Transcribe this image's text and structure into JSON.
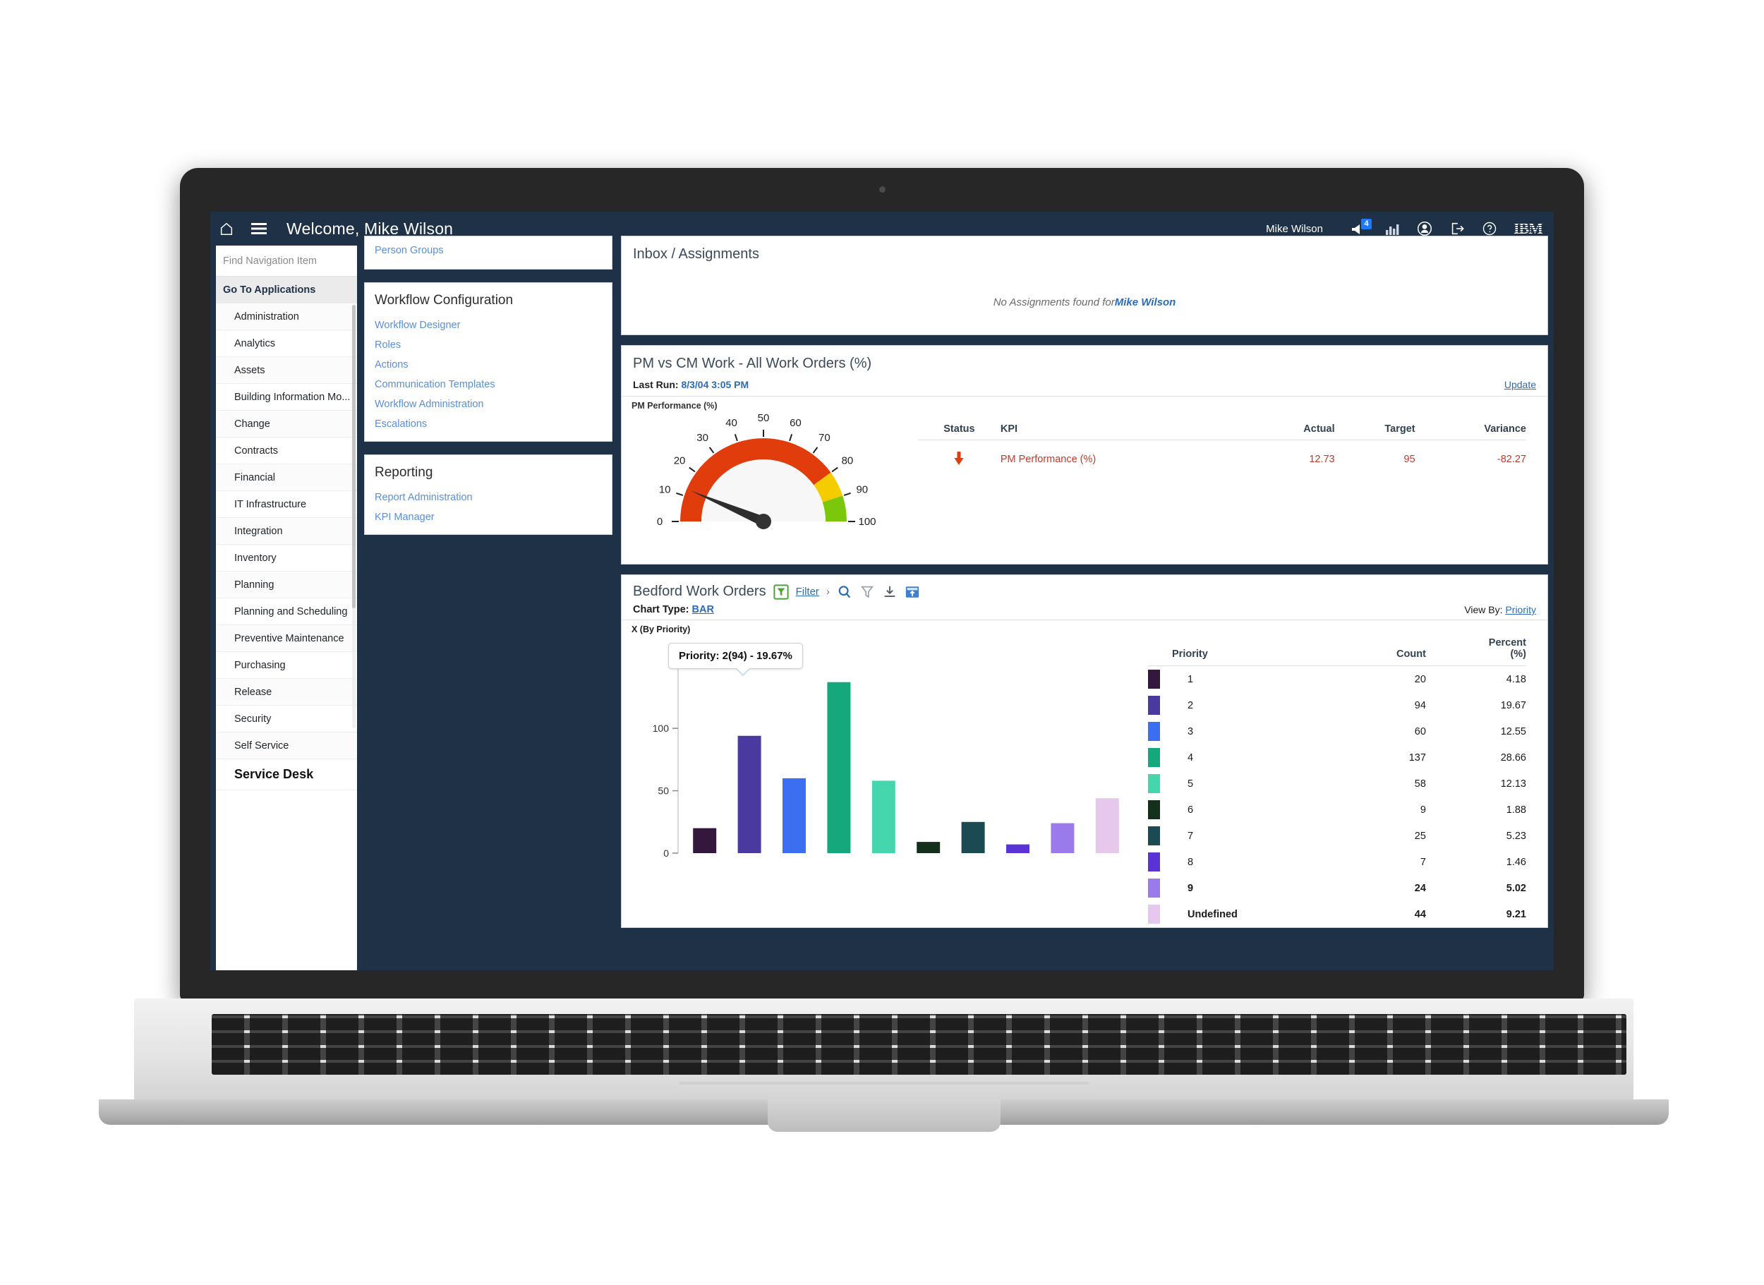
{
  "header": {
    "title": "Welcome, Mike Wilson",
    "user": "Mike Wilson",
    "notification_count": "4",
    "brand": "IBM",
    "icons": [
      "home-icon",
      "hamburger-menu-icon",
      "megaphone-icon",
      "bar-chart-icon",
      "profile-icon",
      "logout-icon",
      "help-icon"
    ]
  },
  "sidebar": {
    "search_placeholder": "Find Navigation Item",
    "section_label": "Go To Applications",
    "items": [
      {
        "label": "Administration"
      },
      {
        "label": "Analytics"
      },
      {
        "label": "Assets"
      },
      {
        "label": "Building Information Mo..."
      },
      {
        "label": "Change"
      },
      {
        "label": "Contracts"
      },
      {
        "label": "Financial"
      },
      {
        "label": "IT Infrastructure"
      },
      {
        "label": "Integration"
      },
      {
        "label": "Inventory"
      },
      {
        "label": "Planning"
      },
      {
        "label": "Planning and Scheduling"
      },
      {
        "label": "Preventive Maintenance"
      },
      {
        "label": "Purchasing"
      },
      {
        "label": "Release"
      },
      {
        "label": "Security"
      },
      {
        "label": "Self Service"
      },
      {
        "label": "Service Desk",
        "active": true
      }
    ]
  },
  "mid_column": {
    "top_partial_link": "Person Groups",
    "workflow": {
      "title": "Workflow Configuration",
      "links": [
        "Workflow Designer",
        "Roles",
        "Actions",
        "Communication Templates",
        "Workflow Administration",
        "Escalations"
      ]
    },
    "reporting": {
      "title": "Reporting",
      "links": [
        "Report Administration",
        "KPI Manager"
      ]
    }
  },
  "inbox": {
    "title": "Inbox / Assignments",
    "empty_prefix": "No Assignments found for ",
    "empty_user": "Mike Wilson"
  },
  "kpi_panel": {
    "title": "PM vs CM Work - All Work Orders (%)",
    "last_run_label": "Last Run: ",
    "last_run_value": "8/3/04 3:05 PM",
    "update_label": "Update",
    "gauge_axis_label": "PM Performance (%)",
    "columns": [
      "Status",
      "KPI",
      "Actual",
      "Target",
      "Variance"
    ],
    "rows": [
      {
        "status": "down-arrow-icon",
        "kpi": "PM Performance (%)",
        "actual": "12.73",
        "target": "95",
        "variance": "-82.27"
      }
    ],
    "gauge": {
      "value": 12.73,
      "min": 0,
      "max": 100,
      "ticks": [
        "0",
        "10",
        "20",
        "30",
        "40",
        "50",
        "60",
        "70",
        "80",
        "90",
        "100"
      ],
      "bands": [
        {
          "from": 0,
          "to": 80,
          "color": "#e03c0c"
        },
        {
          "from": 80,
          "to": 90,
          "color": "#f5cc00"
        },
        {
          "from": 90,
          "to": 100,
          "color": "#7ac70c"
        }
      ]
    }
  },
  "bedford": {
    "title": "Bedford Work Orders",
    "filter_label": "Filter",
    "chevron": "›",
    "toolbar_icons": [
      "filter-icon",
      "search-icon",
      "clear-filter-icon",
      "download-icon",
      "export-icon"
    ],
    "chart_type_label": "Chart Type: ",
    "chart_type_value": "BAR",
    "view_by_label": "View By: ",
    "view_by_value": "Priority",
    "x_axis_label": "X (By Priority)",
    "tooltip": "Priority: 2(94) - 19.67%",
    "columns": [
      "Priority",
      "Count",
      "Percent (%)"
    ]
  },
  "chart_data": {
    "type": "bar",
    "title": "Bedford Work Orders",
    "xlabel": "X (By Priority)",
    "ylabel": "",
    "ylim": [
      0,
      137
    ],
    "yticks": [
      0,
      50,
      100
    ],
    "grid": false,
    "legend_position": "right-table",
    "categories": [
      "1",
      "2",
      "3",
      "4",
      "5",
      "6",
      "7",
      "8",
      "9",
      "Undefined"
    ],
    "values": [
      20,
      94,
      60,
      137,
      58,
      9,
      25,
      7,
      24,
      44
    ],
    "percents": [
      4.18,
      19.67,
      12.55,
      28.66,
      12.13,
      1.88,
      5.23,
      1.46,
      5.02,
      9.21
    ],
    "colors": [
      "#33173d",
      "#4a3aa0",
      "#3b6ef0",
      "#14a87c",
      "#45d6ae",
      "#14301c",
      "#1c4a52",
      "#5a33d6",
      "#9b7bec",
      "#e6c8ec"
    ],
    "annotation": "Priority: 2(94) - 19.67%"
  }
}
